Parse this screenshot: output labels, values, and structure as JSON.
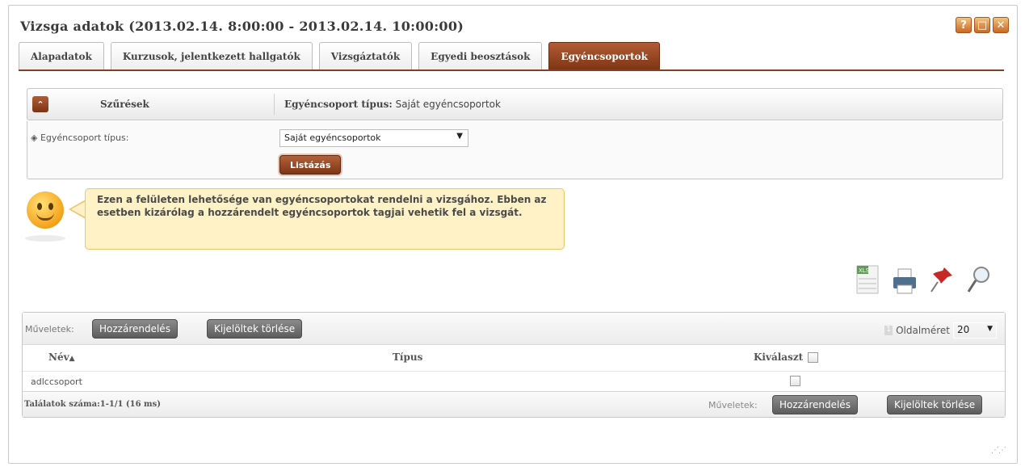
{
  "window": {
    "title": "Vizsga adatok (2013.02.14. 8:00:00 - 2013.02.14. 10:00:00)",
    "buttons": [
      {
        "label": "?",
        "icon": "help-icon"
      },
      {
        "label": "□",
        "icon": "maximize-icon"
      },
      {
        "label": "✕",
        "icon": "close-icon"
      }
    ]
  },
  "tabs": [
    {
      "label": "Alapadatok"
    },
    {
      "label": "Kurzusok, jelentkezett hallgatók"
    },
    {
      "label": "Vizsgáztatók"
    },
    {
      "label": "Egyedi beosztások"
    },
    {
      "label": "Egyéncsoportok",
      "active": true
    }
  ],
  "filter": {
    "title": "Szűrések",
    "summary_label": "Egyéncsoport típus:",
    "summary_value": "Saját egyéncsoportok",
    "field_label": "Egyéncsoport típus:",
    "field_value": "Saját egyéncsoportok",
    "list_button": "Listázás"
  },
  "info": {
    "text": "Ezen a felületen lehetősége van egyéncsoportokat rendelni a vizsgához. Ebben az esetben kizárólag a hozzárendelt egyéncsoportok tagjai vehetik fel a vizsgát."
  },
  "toolbar_icons": [
    "xls-export-icon",
    "print-icon",
    "pin-icon",
    "search-icon"
  ],
  "grid": {
    "ops_label": "Műveletek:",
    "assign_button": "Hozzárendelés",
    "delete_button": "Kijelöltek törlése",
    "page_number": "1",
    "page_size_label": "Oldalméret",
    "page_size_value": "20",
    "columns": {
      "name": "Név",
      "sort_indicator": "▲",
      "type": "Típus",
      "select": "Kiválaszt"
    },
    "rows": [
      {
        "name": "adlccsoport",
        "type": ""
      }
    ],
    "footer_text": "Találatok száma:1-1/1 (16 ms)",
    "footer_ops_label": "Műveletek:"
  },
  "colors": {
    "accent": "#8b3d1c",
    "info_bg": "#fff2c6",
    "info_border": "#f0c46a"
  }
}
